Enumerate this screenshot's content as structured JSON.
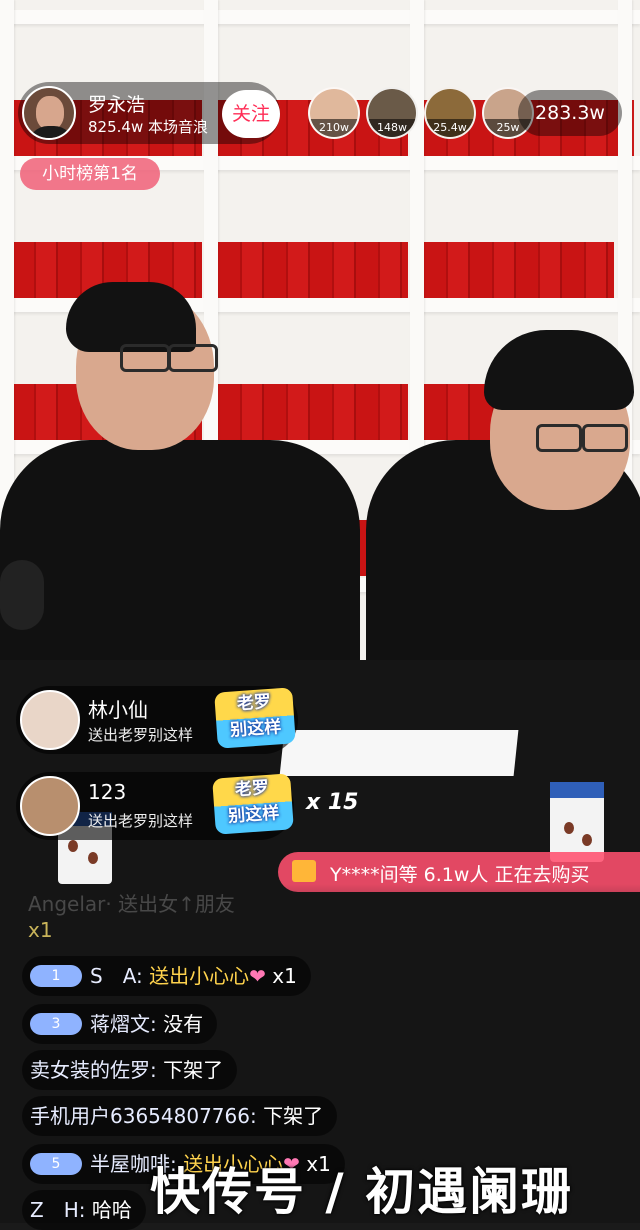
{
  "host": {
    "name": "罗永浩",
    "stat": "825.4w 本场音浪",
    "follow_label": "关注"
  },
  "top_viewers": [
    {
      "badge": "210w"
    },
    {
      "badge": "148w"
    },
    {
      "badge": "25.4w"
    },
    {
      "badge": "25w"
    }
  ],
  "viewer_count": "283.3w",
  "rank_tag": "小时榜第1名",
  "gifts": [
    {
      "user": "林小仙",
      "action": "送出老罗别这样",
      "gift_label_top": "老罗",
      "gift_label_bottom": "别这样"
    },
    {
      "user": "123",
      "action": "送出老罗别这样",
      "gift_label_top": "老罗",
      "gift_label_bottom": "别这样",
      "combo": "x 15"
    }
  ],
  "purchase_banner": "Y****间等 6.1w人 正在去购买",
  "faded_message": {
    "user": "Angelar·",
    "text": "送出女↑朋友",
    "count": "x1"
  },
  "chat": [
    {
      "level": "1",
      "user": "S　A:",
      "text": "送出小心心",
      "gift_icon": "heart-icon",
      "count": "x1"
    },
    {
      "level": "3",
      "user": "蒋熠文:",
      "text": "没有"
    },
    {
      "user": "卖女装的佐罗:",
      "text": "下架了"
    },
    {
      "user": "手机用户63654807766:",
      "text": "下架了"
    },
    {
      "level": "5",
      "user": "半屋咖啡:",
      "text": "送出小心心",
      "gift_icon": "heart-icon",
      "count": "x1"
    },
    {
      "user": "Z　H:",
      "text": "哈哈"
    }
  ],
  "watermark": "快传号 / 初遇阑珊",
  "colors": {
    "accent_pink": "#ff2c55",
    "gift_text": "#ffd34d",
    "level_badge": "#8fb3ff",
    "purchase_banner": "#ff506e"
  }
}
